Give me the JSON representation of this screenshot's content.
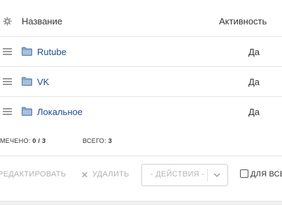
{
  "header": {
    "name_label": "Название",
    "active_label": "Активность",
    "settings_icon": "gear-icon"
  },
  "rows": [
    {
      "name": "Rutube",
      "active": "Да",
      "icon": "folder-icon"
    },
    {
      "name": "VK",
      "active": "Да",
      "icon": "folder-icon"
    },
    {
      "name": "Локальное",
      "active": "Да",
      "icon": "folder-icon"
    }
  ],
  "footer": {
    "selected_label": "МЕЧЕНО:",
    "selected_value": "0 / 3",
    "total_label": "ВСЕГО:",
    "total_value": "3"
  },
  "toolbar": {
    "edit_label": "РЕДАКТИРОВАТЬ",
    "delete_label": "УДАЛИТЬ",
    "actions_placeholder": "- ДЕЙСТВИЯ -",
    "for_all_label": "ДЛЯ ВСЕХ"
  },
  "colors": {
    "link": "#1f4b8e",
    "folder": "#6f8fb8",
    "disabled": "#b0b0b0"
  }
}
